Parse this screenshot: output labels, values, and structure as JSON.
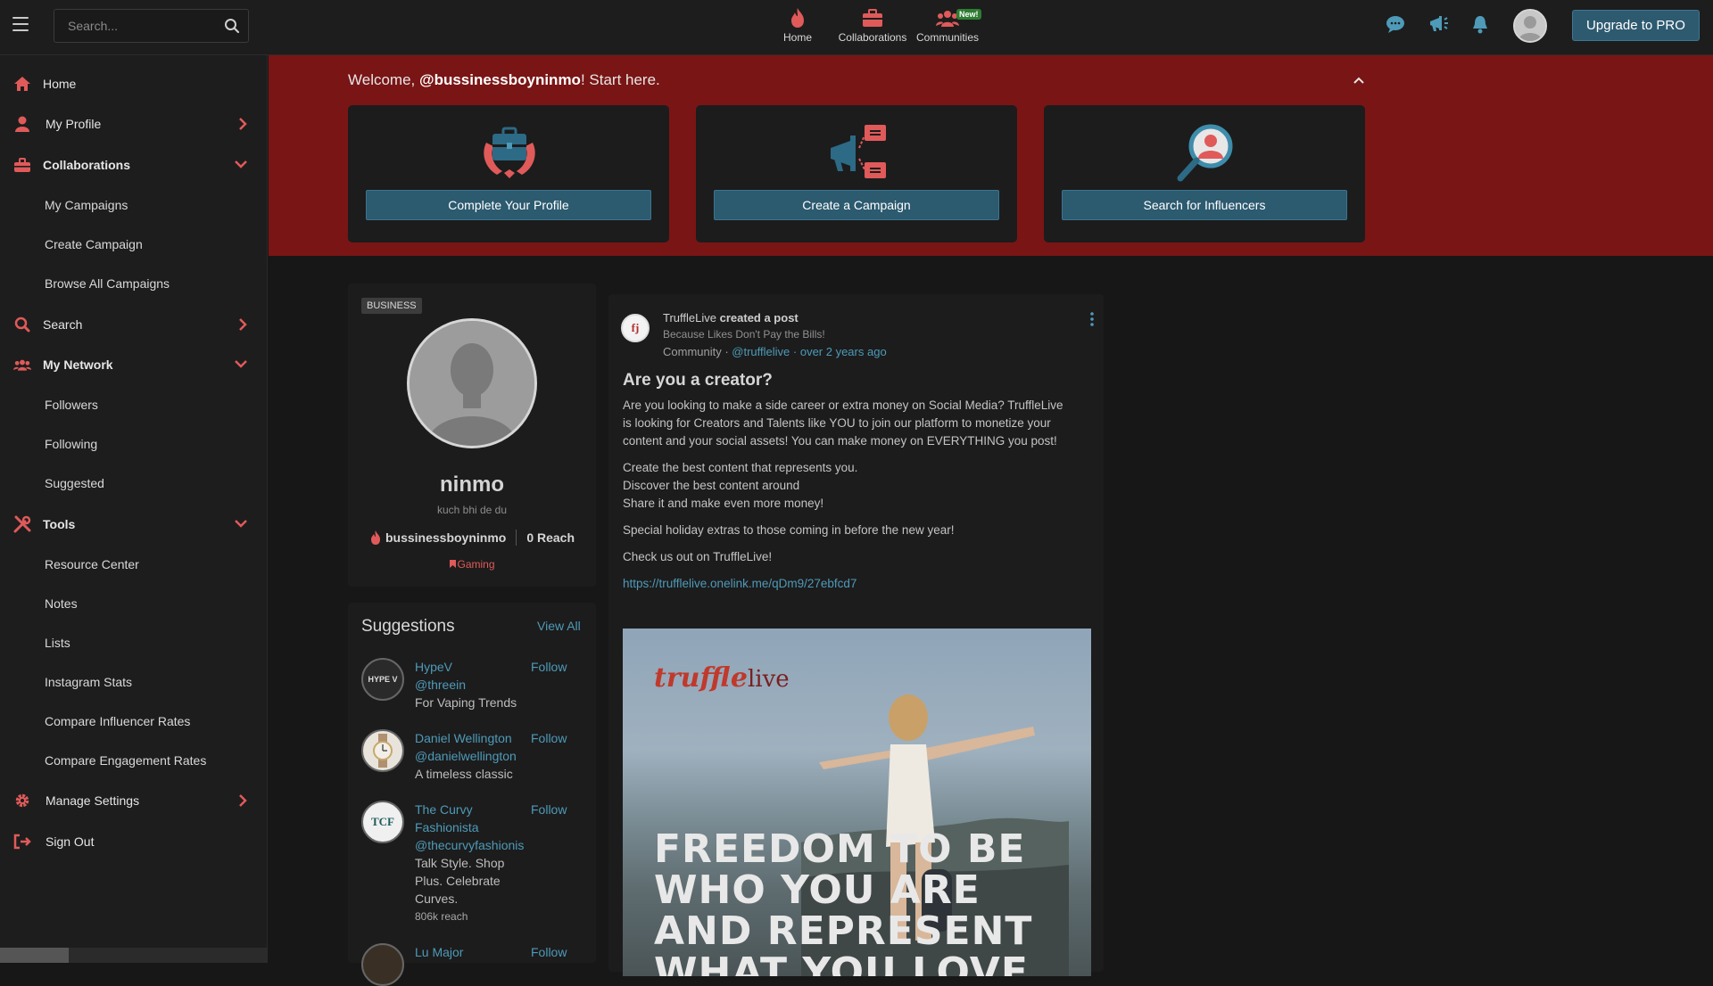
{
  "topbar": {
    "search_placeholder": "Search...",
    "nav": [
      {
        "label": "Home",
        "icon": "flame-icon"
      },
      {
        "label": "Collaborations",
        "icon": "briefcase-icon"
      },
      {
        "label": "Communities",
        "icon": "people-icon",
        "badge": "New!"
      }
    ],
    "upgrade_label": "Upgrade to PRO"
  },
  "sidebar": {
    "items": [
      {
        "label": "Home",
        "icon": "home-icon"
      },
      {
        "label": "My Profile",
        "icon": "user-icon"
      },
      {
        "label": "Collaborations",
        "icon": "briefcase-icon"
      },
      {
        "label": "Search",
        "icon": "search-icon"
      },
      {
        "label": "My Network",
        "icon": "network-icon"
      },
      {
        "label": "Tools",
        "icon": "tools-icon"
      },
      {
        "label": "Manage Settings",
        "icon": "gear-icon"
      },
      {
        "label": "Sign Out",
        "icon": "signout-icon"
      }
    ],
    "collaborations_sub": [
      "My Campaigns",
      "Create Campaign",
      "Browse All Campaigns"
    ],
    "network_sub": [
      "Followers",
      "Following",
      "Suggested"
    ],
    "tools_sub": [
      "Resource Center",
      "Notes",
      "Lists",
      "Instagram Stats",
      "Compare Influencer Rates",
      "Compare Engagement Rates"
    ]
  },
  "banner": {
    "welcome_prefix": "Welcome, ",
    "welcome_user": "@bussinessboyninmo",
    "welcome_suffix": "! Start here.",
    "cards": [
      {
        "label": "Complete Your Profile"
      },
      {
        "label": "Create a Campaign"
      },
      {
        "label": "Search for Influencers"
      }
    ]
  },
  "profile": {
    "type_tag": "BUSINESS",
    "name": "ninmo",
    "tagline": "kuch bhi de du",
    "handle": "bussinessboyninmo",
    "reach": "0 Reach",
    "category": "Gaming"
  },
  "suggestions": {
    "title": "Suggestions",
    "view_all": "View All",
    "follow_label": "Follow",
    "items": [
      {
        "name": "HypeV",
        "handle": "@threein",
        "desc": "For Vaping Trends",
        "reach": "",
        "avatar_text": "HYPE V"
      },
      {
        "name": "Daniel Wellington",
        "handle": "@danielwellington",
        "desc": "A timeless classic",
        "reach": "",
        "avatar_text": ""
      },
      {
        "name": "The Curvy Fashionista",
        "handle": "@thecurvyfashionis",
        "desc": "Talk Style. Shop Plus. Celebrate Curves.",
        "reach": "806k reach",
        "avatar_text": "TCF"
      },
      {
        "name": "Lu Major",
        "handle": "",
        "desc": "",
        "reach": "",
        "avatar_text": ""
      }
    ]
  },
  "post": {
    "author": "TruffleLive",
    "action": "created a post",
    "subtitle": "Because Likes Don't Pay the Bills!",
    "community_label": "Community · ",
    "community_handle": "@trufflelive",
    "time": " · over 2 years ago",
    "title": "Are you a creator?",
    "para1": "Are you looking to make a side career or extra money on Social Media? TruffleLive is looking for Creators and Talents like YOU to join our platform to monetize your content and your social assets! You can make money on EVERYTHING you post!",
    "line1": "Create the best content that represents you.",
    "line2": "Discover the best content around",
    "line3": "Share it and make even more money!",
    "para3": "Special holiday extras to those coming in before the new year!",
    "para4": "Check us out on TruffleLive!",
    "link": "https://trufflelive.onelink.me/qDm9/27ebfcd7",
    "image_logo_a": "truffle",
    "image_logo_b": "live",
    "image_text_1": "FREEDOM TO BE",
    "image_text_2": "WHO YOU ARE",
    "image_text_3": "AND REPRESENT",
    "image_text_4": "WHAT YOU LOVE"
  },
  "colors": {
    "accent_red": "#e05a5a",
    "banner_red": "#7a1515",
    "button_teal": "#2c5a6f",
    "link_blue": "#4e9ab8"
  }
}
